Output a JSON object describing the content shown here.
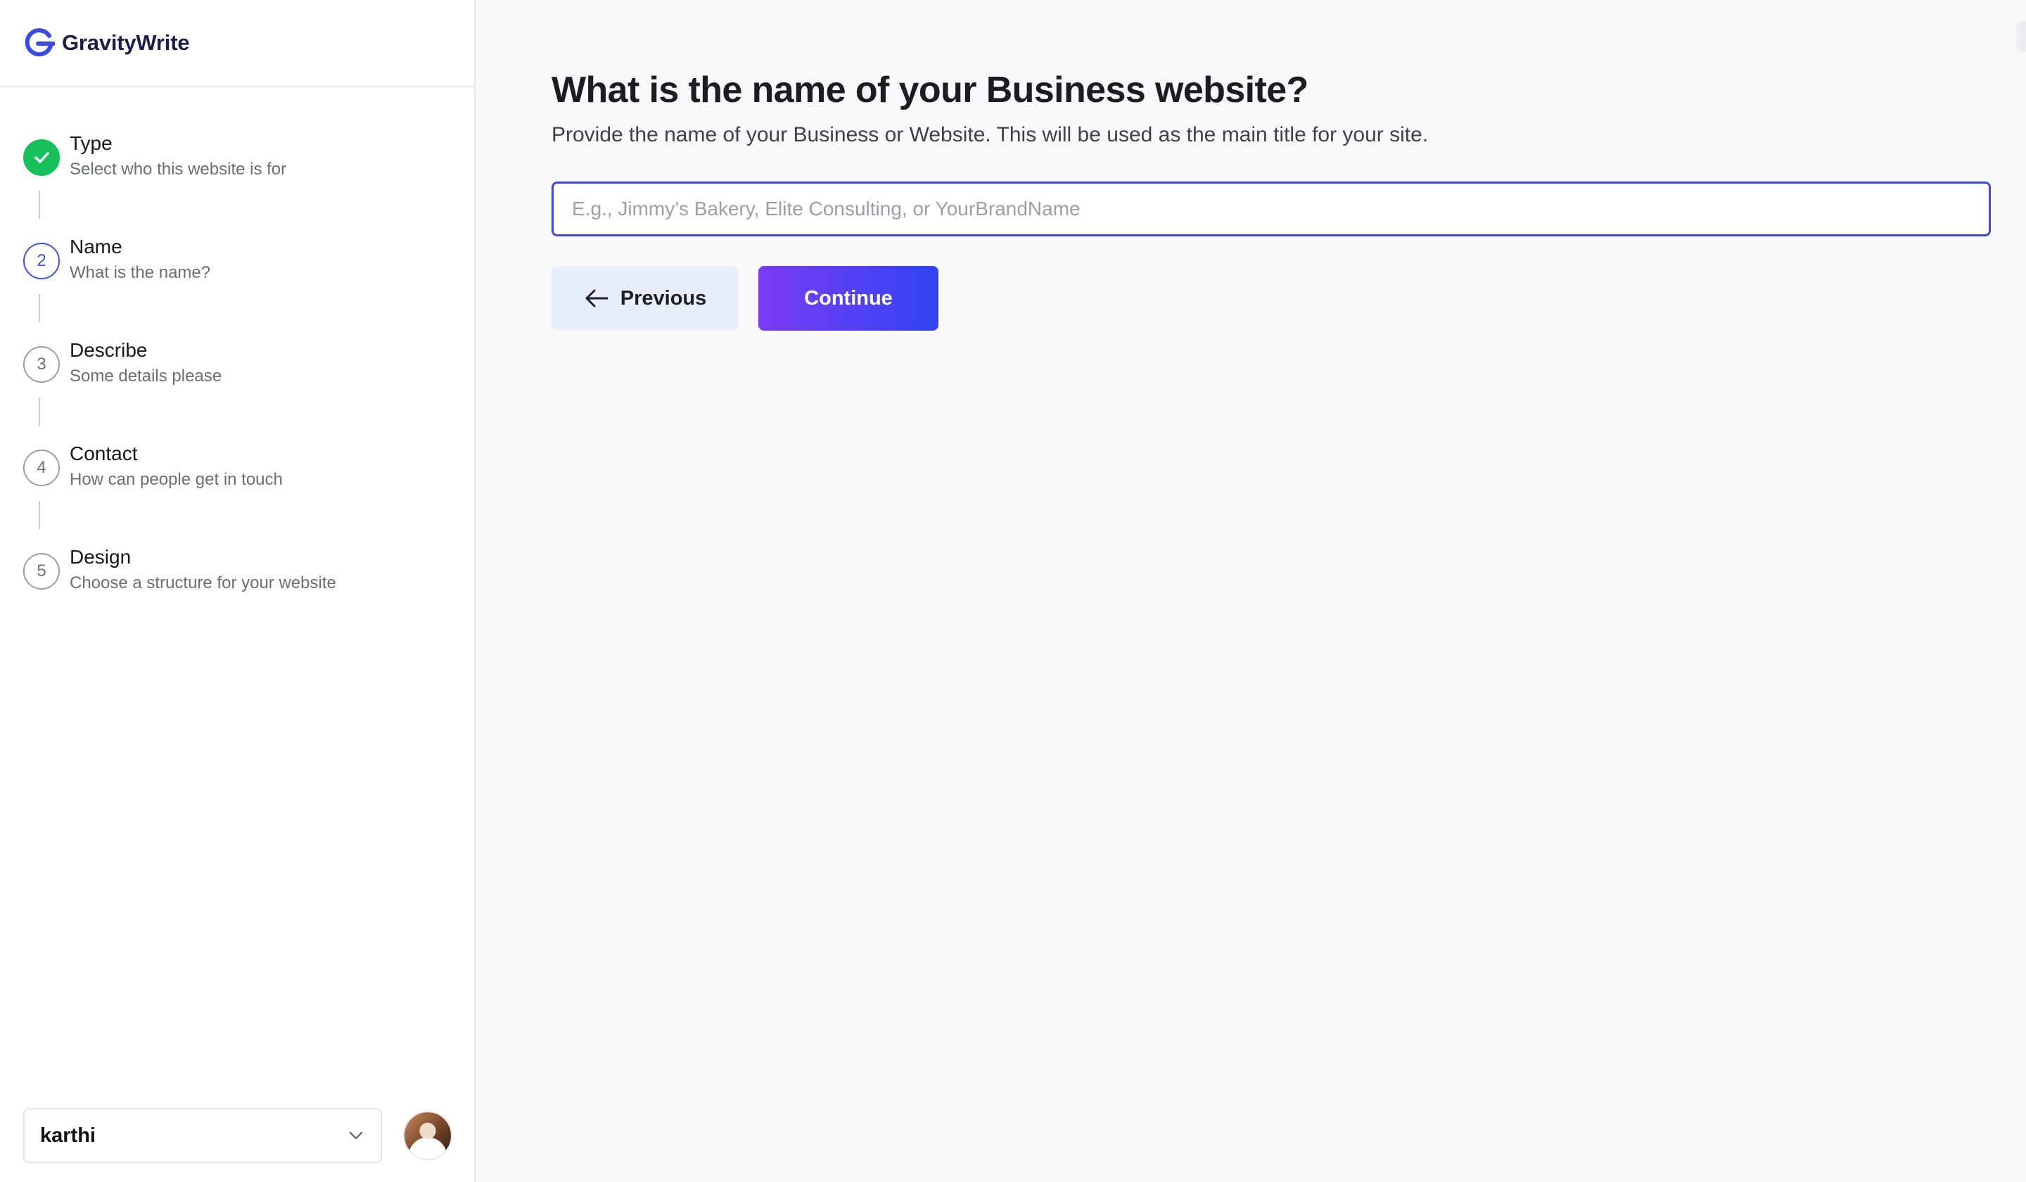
{
  "brand": {
    "name": "GravityWrite"
  },
  "steps": [
    {
      "number": "",
      "title": "Type",
      "subtitle": "Select who this website is for",
      "state": "done"
    },
    {
      "number": "2",
      "title": "Name",
      "subtitle": "What is the name?",
      "state": "active"
    },
    {
      "number": "3",
      "title": "Describe",
      "subtitle": "Some details please",
      "state": "pending"
    },
    {
      "number": "4",
      "title": "Contact",
      "subtitle": "How can people get in touch",
      "state": "pending"
    },
    {
      "number": "5",
      "title": "Design",
      "subtitle": "Choose a structure for your website",
      "state": "pending"
    }
  ],
  "account": {
    "name": "karthi",
    "icon": "chevron-down-icon"
  },
  "main": {
    "heading": "What is the name of your Business website?",
    "subheading": "Provide the name of your Business or Website. This will be used as the main title for your site.",
    "input": {
      "value": "",
      "placeholder": "E.g., Jimmy’s Bakery, Elite Consulting, or YourBrandName"
    },
    "previous_label": "Previous",
    "continue_label": "Continue"
  },
  "colors": {
    "accent": "#3c4ad8",
    "done": "#16c05a",
    "continue_gradient_start": "#7b3cf4",
    "continue_gradient_end": "#3144f4",
    "previous_bg": "#e8effb"
  }
}
